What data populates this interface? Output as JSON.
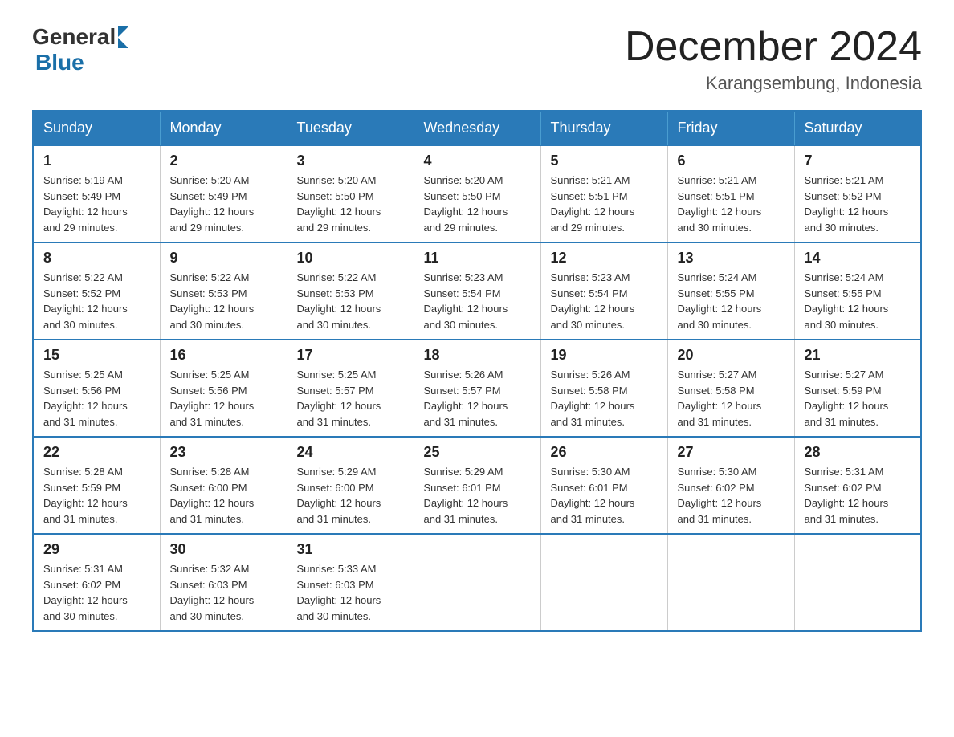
{
  "logo": {
    "general": "General",
    "blue": "Blue",
    "arrow_color": "#1a6fa8"
  },
  "header": {
    "month_year": "December 2024",
    "location": "Karangsembung, Indonesia"
  },
  "weekdays": [
    "Sunday",
    "Monday",
    "Tuesday",
    "Wednesday",
    "Thursday",
    "Friday",
    "Saturday"
  ],
  "weeks": [
    [
      {
        "day": "1",
        "sunrise": "5:19 AM",
        "sunset": "5:49 PM",
        "daylight": "12 hours and 29 minutes."
      },
      {
        "day": "2",
        "sunrise": "5:20 AM",
        "sunset": "5:49 PM",
        "daylight": "12 hours and 29 minutes."
      },
      {
        "day": "3",
        "sunrise": "5:20 AM",
        "sunset": "5:50 PM",
        "daylight": "12 hours and 29 minutes."
      },
      {
        "day": "4",
        "sunrise": "5:20 AM",
        "sunset": "5:50 PM",
        "daylight": "12 hours and 29 minutes."
      },
      {
        "day": "5",
        "sunrise": "5:21 AM",
        "sunset": "5:51 PM",
        "daylight": "12 hours and 29 minutes."
      },
      {
        "day": "6",
        "sunrise": "5:21 AM",
        "sunset": "5:51 PM",
        "daylight": "12 hours and 30 minutes."
      },
      {
        "day": "7",
        "sunrise": "5:21 AM",
        "sunset": "5:52 PM",
        "daylight": "12 hours and 30 minutes."
      }
    ],
    [
      {
        "day": "8",
        "sunrise": "5:22 AM",
        "sunset": "5:52 PM",
        "daylight": "12 hours and 30 minutes."
      },
      {
        "day": "9",
        "sunrise": "5:22 AM",
        "sunset": "5:53 PM",
        "daylight": "12 hours and 30 minutes."
      },
      {
        "day": "10",
        "sunrise": "5:22 AM",
        "sunset": "5:53 PM",
        "daylight": "12 hours and 30 minutes."
      },
      {
        "day": "11",
        "sunrise": "5:23 AM",
        "sunset": "5:54 PM",
        "daylight": "12 hours and 30 minutes."
      },
      {
        "day": "12",
        "sunrise": "5:23 AM",
        "sunset": "5:54 PM",
        "daylight": "12 hours and 30 minutes."
      },
      {
        "day": "13",
        "sunrise": "5:24 AM",
        "sunset": "5:55 PM",
        "daylight": "12 hours and 30 minutes."
      },
      {
        "day": "14",
        "sunrise": "5:24 AM",
        "sunset": "5:55 PM",
        "daylight": "12 hours and 30 minutes."
      }
    ],
    [
      {
        "day": "15",
        "sunrise": "5:25 AM",
        "sunset": "5:56 PM",
        "daylight": "12 hours and 31 minutes."
      },
      {
        "day": "16",
        "sunrise": "5:25 AM",
        "sunset": "5:56 PM",
        "daylight": "12 hours and 31 minutes."
      },
      {
        "day": "17",
        "sunrise": "5:25 AM",
        "sunset": "5:57 PM",
        "daylight": "12 hours and 31 minutes."
      },
      {
        "day": "18",
        "sunrise": "5:26 AM",
        "sunset": "5:57 PM",
        "daylight": "12 hours and 31 minutes."
      },
      {
        "day": "19",
        "sunrise": "5:26 AM",
        "sunset": "5:58 PM",
        "daylight": "12 hours and 31 minutes."
      },
      {
        "day": "20",
        "sunrise": "5:27 AM",
        "sunset": "5:58 PM",
        "daylight": "12 hours and 31 minutes."
      },
      {
        "day": "21",
        "sunrise": "5:27 AM",
        "sunset": "5:59 PM",
        "daylight": "12 hours and 31 minutes."
      }
    ],
    [
      {
        "day": "22",
        "sunrise": "5:28 AM",
        "sunset": "5:59 PM",
        "daylight": "12 hours and 31 minutes."
      },
      {
        "day": "23",
        "sunrise": "5:28 AM",
        "sunset": "6:00 PM",
        "daylight": "12 hours and 31 minutes."
      },
      {
        "day": "24",
        "sunrise": "5:29 AM",
        "sunset": "6:00 PM",
        "daylight": "12 hours and 31 minutes."
      },
      {
        "day": "25",
        "sunrise": "5:29 AM",
        "sunset": "6:01 PM",
        "daylight": "12 hours and 31 minutes."
      },
      {
        "day": "26",
        "sunrise": "5:30 AM",
        "sunset": "6:01 PM",
        "daylight": "12 hours and 31 minutes."
      },
      {
        "day": "27",
        "sunrise": "5:30 AM",
        "sunset": "6:02 PM",
        "daylight": "12 hours and 31 minutes."
      },
      {
        "day": "28",
        "sunrise": "5:31 AM",
        "sunset": "6:02 PM",
        "daylight": "12 hours and 31 minutes."
      }
    ],
    [
      {
        "day": "29",
        "sunrise": "5:31 AM",
        "sunset": "6:02 PM",
        "daylight": "12 hours and 30 minutes."
      },
      {
        "day": "30",
        "sunrise": "5:32 AM",
        "sunset": "6:03 PM",
        "daylight": "12 hours and 30 minutes."
      },
      {
        "day": "31",
        "sunrise": "5:33 AM",
        "sunset": "6:03 PM",
        "daylight": "12 hours and 30 minutes."
      },
      null,
      null,
      null,
      null
    ]
  ],
  "labels": {
    "sunrise": "Sunrise:",
    "sunset": "Sunset:",
    "daylight": "Daylight:"
  }
}
